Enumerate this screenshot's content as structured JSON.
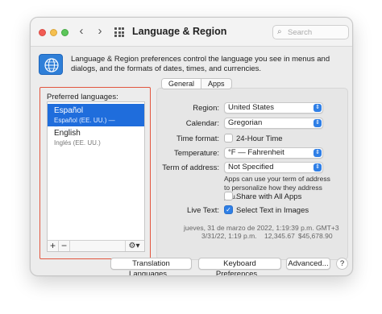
{
  "window": {
    "title": "Language & Region"
  },
  "search": {
    "placeholder": "Search"
  },
  "description": "Language & Region preferences control the language you see in menus and dialogs, and the formats of dates, times, and currencies.",
  "preferred": {
    "label": "Preferred languages:",
    "items": [
      {
        "name": "Español",
        "sub": "Español (EE. UU.) — Primary"
      },
      {
        "name": "English",
        "sub": "Inglés (EE. UU.)"
      }
    ],
    "add": "+",
    "remove": "−"
  },
  "tabs": [
    "General",
    "Apps"
  ],
  "settings": {
    "region": {
      "label": "Region:",
      "value": "United States"
    },
    "calendar": {
      "label": "Calendar:",
      "value": "Gregorian"
    },
    "time_format": {
      "label": "Time format:",
      "checkbox": "24-Hour Time"
    },
    "temperature": {
      "label": "Temperature:",
      "value": "°F — Fahrenheit"
    },
    "term": {
      "label": "Term of address:",
      "value": "Not Specified",
      "help": "Apps can use your term of address to personalize how they address you.",
      "share": "Share with All Apps"
    },
    "live_text": {
      "label": "Live Text:",
      "checkbox": "Select Text in Images"
    }
  },
  "format_sample": {
    "line1": "jueves, 31 de marzo de 2022, 1:19:39 p.m. GMT+3",
    "line2a": "3/31/22, 1:19 p.m.",
    "line2b": "12,345.67",
    "line2c": "$45,678.90"
  },
  "buttons": {
    "translation": "Translation Languages...",
    "keyboard": "Keyboard Preferences...",
    "advanced": "Advanced...",
    "help": "?"
  },
  "colors": {
    "accent": "#2f7fe6",
    "selection": "#1f6ddc",
    "highlight_box": "#e2563f"
  }
}
